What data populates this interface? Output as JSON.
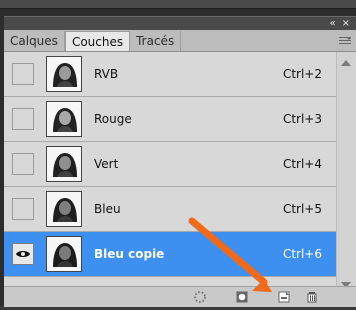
{
  "panel": {
    "tabs": [
      {
        "label": "Calques"
      },
      {
        "label": "Couches"
      },
      {
        "label": "Tracés"
      }
    ],
    "rows": [
      {
        "name": "RVB",
        "shortcut": "Ctrl+2",
        "selected": false
      },
      {
        "name": "Rouge",
        "shortcut": "Ctrl+3",
        "selected": false
      },
      {
        "name": "Vert",
        "shortcut": "Ctrl+4",
        "selected": false
      },
      {
        "name": "Bleu",
        "shortcut": "Ctrl+5",
        "selected": false
      },
      {
        "name": "Bleu copie",
        "shortcut": "Ctrl+6",
        "selected": true
      }
    ],
    "header_glyphs": {
      "collapse": "«",
      "close": "×"
    }
  },
  "colors": {
    "selection": "#3d8ff0",
    "annotation_arrow": "#f06a1b"
  },
  "icons": [
    "eye-icon",
    "channel-thumbnail",
    "panel-menu-icon",
    "dotted-circle-icon",
    "mask-icon",
    "new-channel-icon",
    "trash-icon"
  ]
}
